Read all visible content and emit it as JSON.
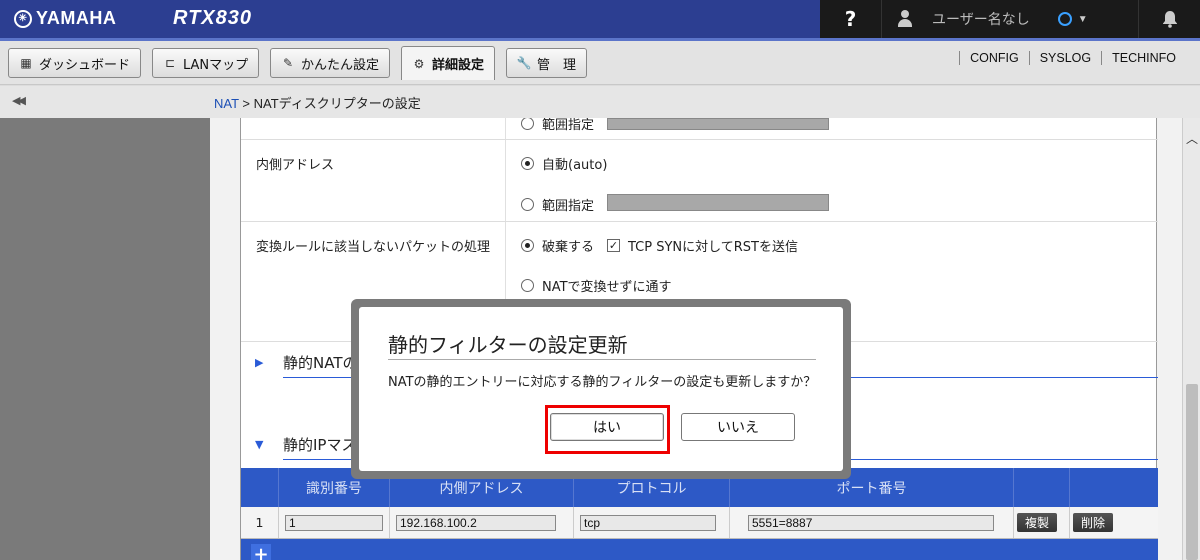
{
  "header": {
    "brand": "YAMAHA",
    "model": "RTX830",
    "help_label": "?",
    "user_label": "ユーザー名なし"
  },
  "tabs": [
    {
      "label": "ダッシュボード",
      "icon": "dashboard-icon"
    },
    {
      "label": "LANマップ",
      "icon": "lanmap-icon"
    },
    {
      "label": "かんたん設定",
      "icon": "wizard-icon"
    },
    {
      "label": "詳細設定",
      "icon": "gear-icon"
    },
    {
      "label": "管　理",
      "icon": "wrench-icon"
    }
  ],
  "active_tab": "詳細設定",
  "links": [
    "CONFIG",
    "SYSLOG",
    "TECHINFO"
  ],
  "breadcrumb": {
    "link": "NAT",
    "rest": " > NATディスクリプターの設定"
  },
  "form": {
    "partial_range_label": "範囲指定",
    "inner_address": {
      "label": "内側アドレス",
      "opt_auto": "自動(auto)",
      "opt_range": "範囲指定"
    },
    "unmatched": {
      "label": "変換ルールに該当しないパケットの処理",
      "opt_discard": "破棄する",
      "rst_checkbox": "TCP SYNに対してRSTを送信",
      "opt_pass": "NATで変換せずに通す"
    },
    "section_static_nat": "静的NATの",
    "section_static_ipm": "静的IPマス"
  },
  "table": {
    "headers": [
      "",
      "識別番号",
      "内側アドレス",
      "プロトコル",
      "ポート番号",
      "",
      ""
    ],
    "rows": [
      {
        "index": "1",
        "id": "1",
        "inner": "192.168.100.2",
        "protocol": "tcp",
        "port": "5551=8887",
        "copy": "複製",
        "delete": "削除"
      }
    ],
    "add_label": "+"
  },
  "dialog": {
    "title": "静的フィルターの設定更新",
    "message": "NATの静的エントリーに対応する静的フィルターの設定も更新しますか？",
    "yes": "はい",
    "no": "いいえ"
  },
  "colors": {
    "header_bg": "#2c3e91",
    "table_header_bg": "#2d59c6",
    "highlight_border": "#ee0000",
    "link": "#1c4fb5"
  }
}
